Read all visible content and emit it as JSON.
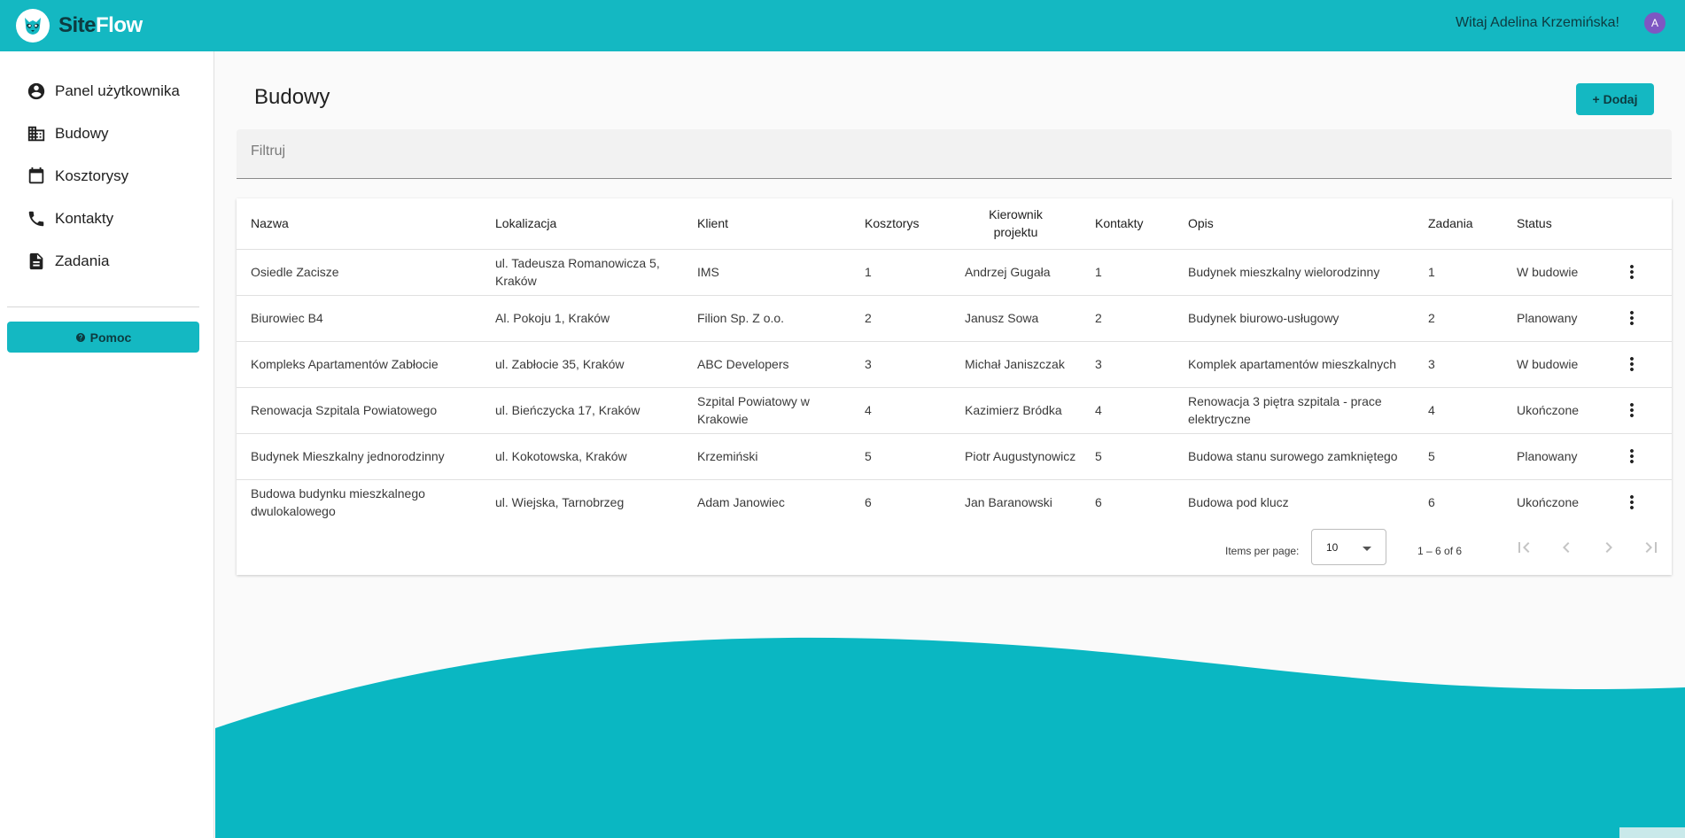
{
  "app": {
    "name_part1": "Site",
    "name_part2": "Flow"
  },
  "header": {
    "greeting": "Witaj Adelina Krzemińska!",
    "avatar_initial": "A"
  },
  "sidebar": {
    "items": [
      {
        "label": "Panel użytkownika",
        "icon": "account-circle-icon"
      },
      {
        "label": "Budowy",
        "icon": "building-icon"
      },
      {
        "label": "Kosztorysy",
        "icon": "calendar-icon"
      },
      {
        "label": "Kontakty",
        "icon": "phone-icon"
      },
      {
        "label": "Zadania",
        "icon": "document-icon"
      }
    ],
    "help_label": "Pomoc"
  },
  "main": {
    "title": "Budowy",
    "add_label": "+ Dodaj",
    "filter_placeholder": "Filtruj"
  },
  "table": {
    "columns": [
      "Nazwa",
      "Lokalizacja",
      "Klient",
      "Kosztorys",
      "Kierownik projektu",
      "Kontakty",
      "Opis",
      "Zadania",
      "Status"
    ],
    "rows": [
      [
        "Osiedle Zacisze",
        "ul. Tadeusza Romanowicza 5, Kraków",
        "IMS",
        "1",
        "Andrzej Gugała",
        "1",
        "Budynek mieszkalny wielorodzinny",
        "1",
        "W budowie"
      ],
      [
        "Biurowiec B4",
        "Al. Pokoju 1, Kraków",
        "Filion Sp. Z o.o.",
        "2",
        "Janusz Sowa",
        "2",
        "Budynek biurowo-usługowy",
        "2",
        "Planowany"
      ],
      [
        "Kompleks Apartamentów Zabłocie",
        "ul. Zabłocie 35, Kraków",
        "ABC Developers",
        "3",
        "Michał Janiszczak",
        "3",
        "Komplek apartamentów mieszkalnych",
        "3",
        "W budowie"
      ],
      [
        "Renowacja Szpitala Powiatowego",
        "ul. Bieńczycka 17, Kraków",
        "Szpital Powiatowy w Krakowie",
        "4",
        "Kazimierz Bródka",
        "4",
        "Renowacja 3 piętra szpitala - prace elektryczne",
        "4",
        "Ukończone"
      ],
      [
        "Budynek Mieszkalny jednorodzinny",
        "ul. Kokotowska, Kraków",
        "Krzemiński",
        "5",
        "Piotr Augustynowicz",
        "5",
        "Budowa stanu surowego zamkniętego",
        "5",
        "Planowany"
      ],
      [
        "Budowa budynku mieszkalnego dwulokalowego",
        "ul. Wiejska, Tarnobrzeg",
        "Adam Janowiec",
        "6",
        "Jan Baranowski",
        "6",
        "Budowa pod klucz",
        "6",
        "Ukończone"
      ]
    ]
  },
  "paginator": {
    "items_per_page_label": "Items per page:",
    "items_per_page_value": "10",
    "range_label": "1 – 6 of 6"
  },
  "colors": {
    "accent": "#14b8c2",
    "dark_text": "#0d3b40",
    "avatar": "#7e57c2"
  }
}
